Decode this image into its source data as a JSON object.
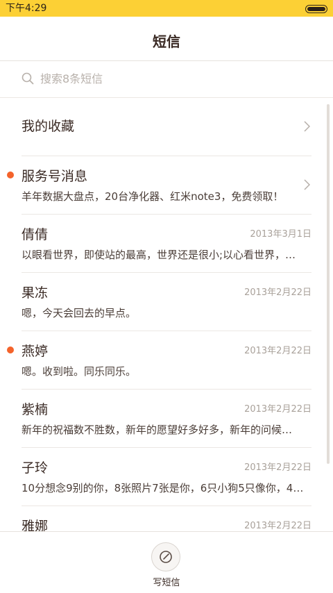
{
  "status_bar": {
    "time": "下午4:29",
    "battery_level": 1.0
  },
  "header": {
    "title": "短信"
  },
  "search": {
    "placeholder": "搜索8条短信",
    "value": ""
  },
  "favorites": {
    "label": "我的收藏"
  },
  "conversations": [
    {
      "name": "服务号消息",
      "preview": "羊年数据大盘点，20台净化器、红米note3，免费领取！",
      "date": "",
      "unread": true
    },
    {
      "name": "倩倩",
      "preview": "以眼看世界，即使站的最高，世界还是很小;以心看世界，…",
      "date": "2013年3月1日",
      "unread": false
    },
    {
      "name": "果冻",
      "preview": "嗯，今天会回去的早点。",
      "date": "2013年2月22日",
      "unread": false
    },
    {
      "name": "燕婷",
      "preview": "嗯。收到啦。同乐同乐。",
      "date": "2013年2月22日",
      "unread": true
    },
    {
      "name": "紫楠",
      "preview": "新年的祝福数不胜数，新年的愿望好多好多，新年的问候…",
      "date": "2013年2月22日",
      "unread": false
    },
    {
      "name": "子玲",
      "preview": "10分想念9别的你，8张照片7张是你，6只小狗5只像你，4…",
      "date": "2013年2月22日",
      "unread": false
    },
    {
      "name": "雅娜",
      "preview": "",
      "date": "2013年2月22日",
      "unread": false
    }
  ],
  "footer": {
    "compose_label": "写短信"
  },
  "colors": {
    "status_bar": "#fcd035",
    "unread_dot": "#f4632b",
    "text": "#3a2a24"
  }
}
